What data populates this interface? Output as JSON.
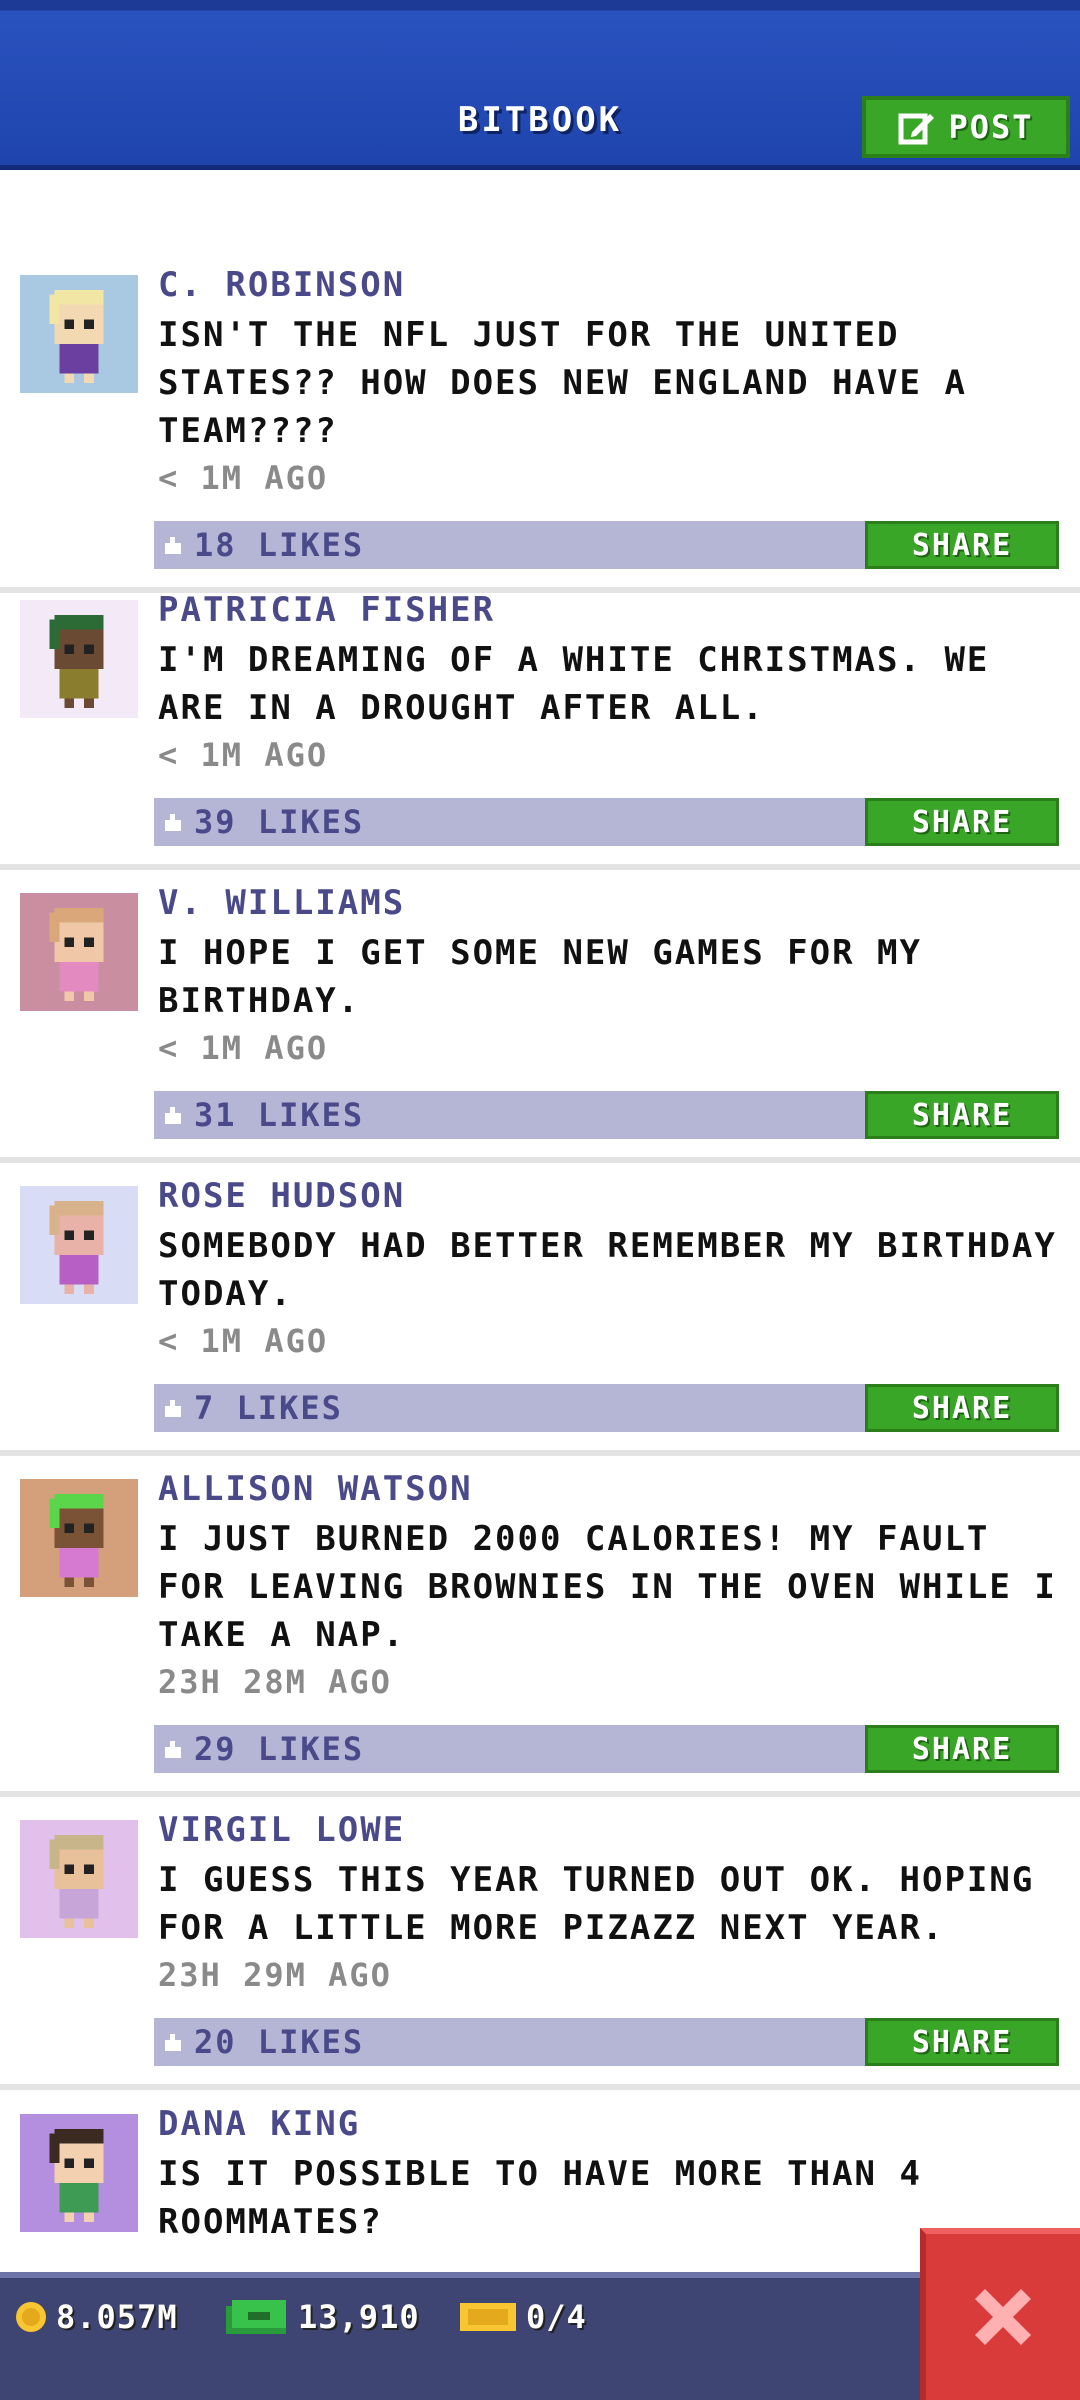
{
  "header": {
    "title": "BITBOOK",
    "post_label": "POST"
  },
  "posts": [
    {
      "name": "C. ROBINSON",
      "message": "ISN'T THE NFL JUST FOR THE UNITED STATES?? HOW DOES NEW ENGLAND HAVE A TEAM????",
      "time": "< 1M AGO",
      "likes": "18 LIKES",
      "share": "SHARE",
      "avatar_bg": "#a9c8e2",
      "skin": "#f2d9b1",
      "hair": "#f1e6a4",
      "shirt": "#6b3fa0"
    },
    {
      "name": "PATRICIA FISHER",
      "message": "I'M DREAMING OF A WHITE CHRISTMAS. WE ARE IN A DROUGHT AFTER ALL.",
      "time": "< 1M AGO",
      "likes": "39 LIKES",
      "share": "SHARE",
      "avatar_bg": "#f4e9f7",
      "skin": "#6b4a34",
      "hair": "#2d6b36",
      "shirt": "#8a7d2d"
    },
    {
      "name": "V. WILLIAMS",
      "message": "I HOPE I GET SOME NEW GAMES FOR MY BIRTHDAY.",
      "time": "< 1M AGO",
      "likes": "31 LIKES",
      "share": "SHARE",
      "avatar_bg": "#c98fa0",
      "skin": "#f0c8a8",
      "hair": "#d9a77a",
      "shirt": "#e38ac0"
    },
    {
      "name": "ROSE HUDSON",
      "message": "SOMEBODY HAD BETTER REMEMBER MY BIRTHDAY TODAY.",
      "time": "< 1M AGO",
      "likes": "7 LIKES",
      "share": "SHARE",
      "avatar_bg": "#d9dcf5",
      "skin": "#e8b2a8",
      "hair": "#d7b28a",
      "shirt": "#b85fc5"
    },
    {
      "name": "ALLISON WATSON",
      "message": "I JUST BURNED 2000 CALORIES! MY FAULT FOR LEAVING BROWNIES IN THE OVEN WHILE I TAKE A NAP.",
      "time": "23H 28M AGO",
      "likes": "29 LIKES",
      "share": "SHARE",
      "avatar_bg": "#d4a07c",
      "skin": "#7a5236",
      "hair": "#5bd64b",
      "shirt": "#d57ad0"
    },
    {
      "name": "VIRGIL LOWE",
      "message": "I GUESS THIS YEAR TURNED OUT OK. HOPING FOR A LITTLE MORE PIZAZZ NEXT YEAR.",
      "time": "23H 29M AGO",
      "likes": "20 LIKES",
      "share": "SHARE",
      "avatar_bg": "#e1c1ec",
      "skin": "#e8c09a",
      "hair": "#c9b58a",
      "shirt": "#c8a5d8"
    },
    {
      "name": "DANA KING",
      "message": "IS IT POSSIBLE TO HAVE MORE THAN 4 ROOMMATES?",
      "time": "",
      "likes": "",
      "share": "",
      "avatar_bg": "#b48fe0",
      "skin": "#f2d0b0",
      "hair": "#3b2a22",
      "shirt": "#3e9b54"
    }
  ],
  "footer": {
    "coins": "8.057M",
    "bux": "13,910",
    "tickets": "0/4"
  }
}
